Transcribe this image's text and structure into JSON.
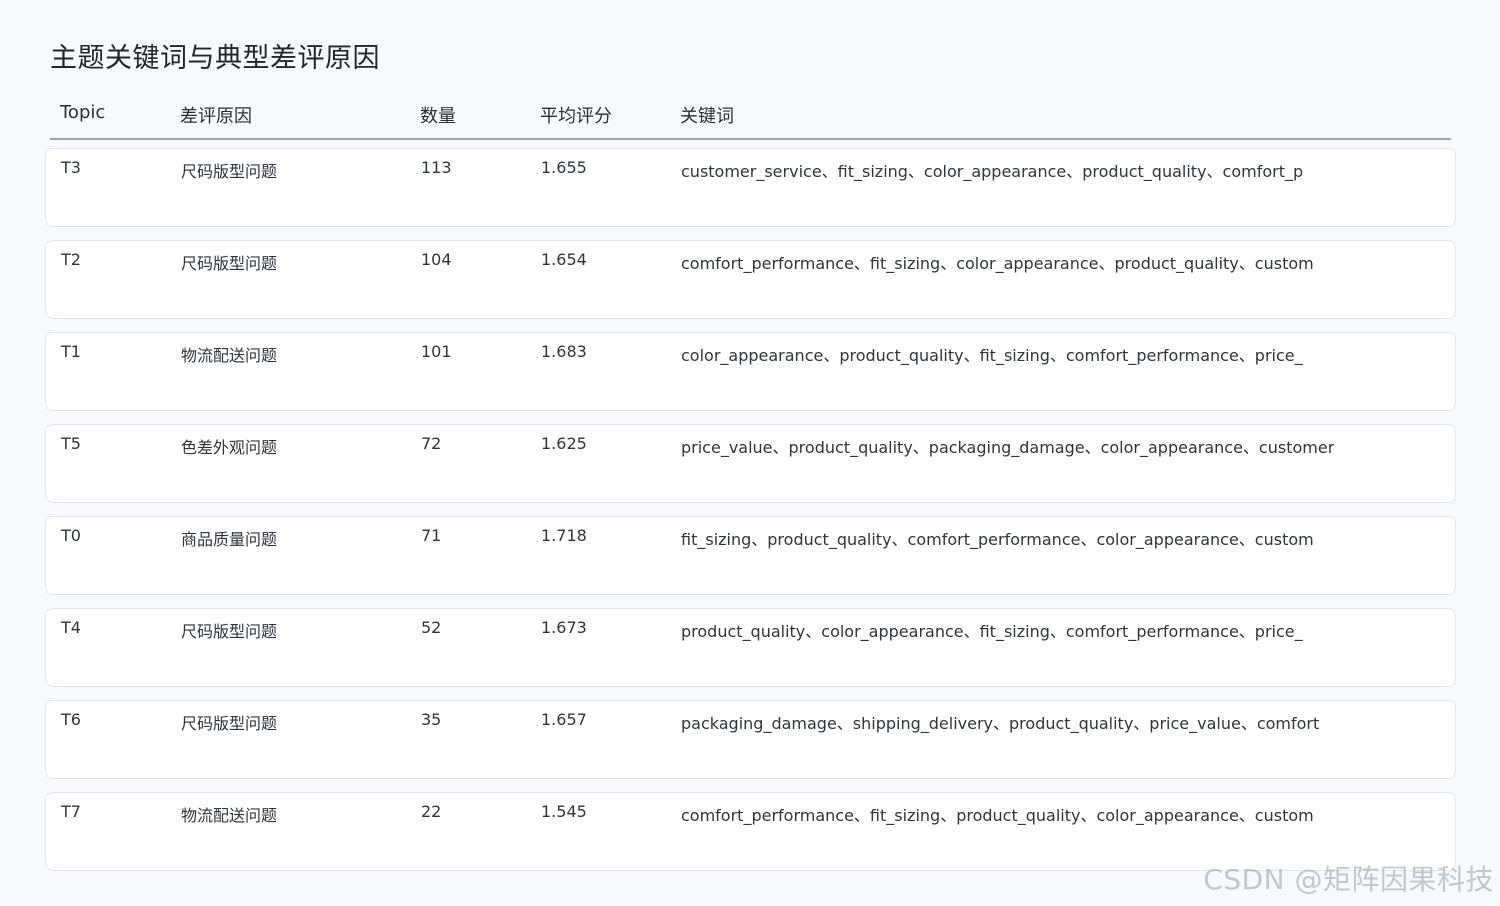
{
  "title": "主题关键词与典型差评原因",
  "columns": {
    "topic": "Topic",
    "reason": "差评原因",
    "count": "数量",
    "rating": "平均评分",
    "keywords": "关键词"
  },
  "rows": [
    {
      "topic": "T3",
      "reason": "尺码版型问题",
      "count": "113",
      "rating": "1.655",
      "keywords": "customer_service、fit_sizing、color_appearance、product_quality、comfort_p"
    },
    {
      "topic": "T2",
      "reason": "尺码版型问题",
      "count": "104",
      "rating": "1.654",
      "keywords": "comfort_performance、fit_sizing、color_appearance、product_quality、custom"
    },
    {
      "topic": "T1",
      "reason": "物流配送问题",
      "count": "101",
      "rating": "1.683",
      "keywords": "color_appearance、product_quality、fit_sizing、comfort_performance、price_"
    },
    {
      "topic": "T5",
      "reason": "色差外观问题",
      "count": "72",
      "rating": "1.625",
      "keywords": "price_value、product_quality、packaging_damage、color_appearance、customer"
    },
    {
      "topic": "T0",
      "reason": "商品质量问题",
      "count": "71",
      "rating": "1.718",
      "keywords": "fit_sizing、product_quality、comfort_performance、color_appearance、custom"
    },
    {
      "topic": "T4",
      "reason": "尺码版型问题",
      "count": "52",
      "rating": "1.673",
      "keywords": "product_quality、color_appearance、fit_sizing、comfort_performance、price_"
    },
    {
      "topic": "T6",
      "reason": "尺码版型问题",
      "count": "35",
      "rating": "1.657",
      "keywords": "packaging_damage、shipping_delivery、product_quality、price_value、comfort"
    },
    {
      "topic": "T7",
      "reason": "物流配送问题",
      "count": "22",
      "rating": "1.545",
      "keywords": "comfort_performance、fit_sizing、product_quality、color_appearance、custom"
    }
  ],
  "watermark": "CSDN @矩阵因果科技"
}
